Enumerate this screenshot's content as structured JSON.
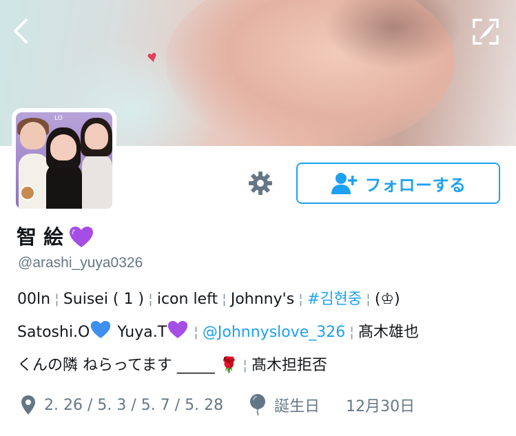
{
  "banner": {
    "description": "cover-photo"
  },
  "nav": {
    "back_icon": "chevron-left-icon",
    "edit_icon": "edit-quill-icon"
  },
  "profile": {
    "name": "智 絵",
    "name_emoji": "purple-heart",
    "handle": "@arashi_yuya0326",
    "avatar_badge_text": "LO"
  },
  "actions": {
    "settings_icon": "gear-icon",
    "follow_label": "フォローする",
    "follow_icon": "person-plus-icon",
    "accent_color": "#1da1f2"
  },
  "bio": {
    "line1": {
      "t1": "00ln",
      "t2": "Suisei ( 1 )",
      "t3": "icon left",
      "t4": "Johnny's",
      "hashtag": "#김현중",
      "t5": "(♔)"
    },
    "line2": {
      "t1": "Satoshi.O",
      "t2": "Yuya.T",
      "mention": "@Johnnyslove_326",
      "t3": "髙木雄也"
    },
    "line3": {
      "t1": "くんの隣 ねらってます _____",
      "rose": "🌹",
      "t2": "髙木担拒否"
    },
    "separator": "¦"
  },
  "meta": {
    "location_icon": "location-pin-icon",
    "location": "2. 26 / 5. 3 / 5. 7 / 5. 28",
    "birthday_icon": "balloon-icon",
    "birthday_label": "誕生日",
    "birthday_value": "12月30日"
  }
}
